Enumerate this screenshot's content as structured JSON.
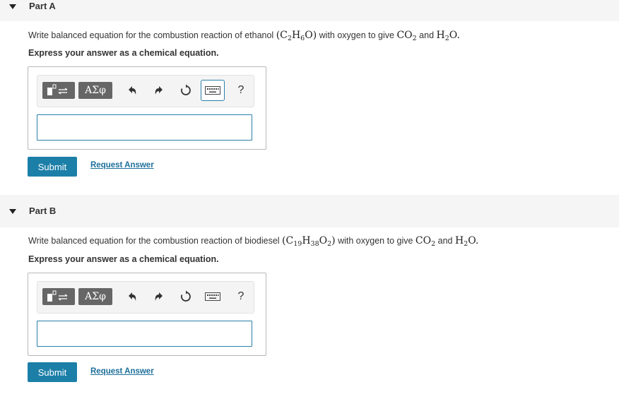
{
  "parts": [
    {
      "title": "Part A",
      "question_prefix": "Write balanced equation for the combustion reaction of ethanol",
      "formula": [
        "C",
        "2",
        "H",
        "6",
        "O"
      ],
      "question_mid": "with oxygen to give",
      "question_and": "and",
      "instruction": "Express your answer as a chemical equation.",
      "toolbar": {
        "greek_label": "ΑΣφ",
        "help_label": "?",
        "keyboard_focused": true
      },
      "input_value": "",
      "submit_label": "Submit",
      "request_label": "Request Answer"
    },
    {
      "title": "Part B",
      "question_prefix": "Write balanced equation for the combustion reaction of biodiesel",
      "formula": [
        "C",
        "19",
        "H",
        "38",
        "O",
        "2"
      ],
      "question_mid": "with oxygen to give",
      "question_and": "and",
      "instruction": "Express your answer as a chemical equation.",
      "toolbar": {
        "greek_label": "ΑΣφ",
        "help_label": "?",
        "keyboard_focused": false
      },
      "input_value": "",
      "submit_label": "Submit",
      "request_label": "Request Answer"
    }
  ],
  "products": {
    "co2": [
      "CO",
      "2"
    ],
    "h2o": [
      "H",
      "2",
      "O"
    ]
  },
  "colors": {
    "accent": "#1c7fa8",
    "link": "#1c6f9a",
    "header_bg": "#f5f5f5"
  },
  "icons": [
    "caret-down-icon",
    "templates-icon",
    "undo-icon",
    "redo-icon",
    "reset-icon",
    "keyboard-icon",
    "help-icon"
  ]
}
